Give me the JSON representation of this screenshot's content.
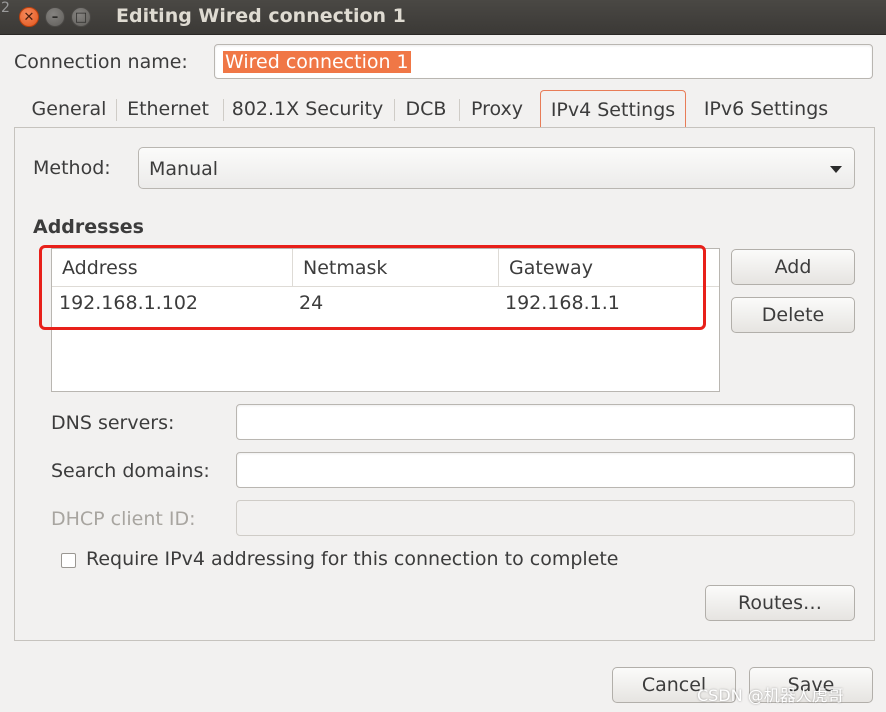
{
  "window": {
    "title": "Editing Wired connection 1",
    "stray_char": "2"
  },
  "connection": {
    "label": "Connection name:",
    "value": "Wired connection 1"
  },
  "tabs": [
    {
      "label": "General"
    },
    {
      "label": "Ethernet"
    },
    {
      "label": "802.1X Security"
    },
    {
      "label": "DCB"
    },
    {
      "label": "Proxy"
    },
    {
      "label": "IPv4 Settings",
      "active": true
    },
    {
      "label": "IPv6 Settings"
    }
  ],
  "method": {
    "label": "Method:",
    "value": "Manual"
  },
  "addresses": {
    "heading": "Addresses",
    "columns": [
      "Address",
      "Netmask",
      "Gateway"
    ],
    "rows": [
      [
        "192.168.1.102",
        "24",
        "192.168.1.1"
      ]
    ],
    "add_label": "Add",
    "delete_label": "Delete"
  },
  "fields": {
    "dns_label": "DNS servers:",
    "dns_value": "",
    "search_label": "Search domains:",
    "search_value": "",
    "dhcp_label": "DHCP client ID:",
    "dhcp_value": ""
  },
  "require_ipv4": {
    "label": "Require IPv4 addressing for this connection to complete",
    "checked": false
  },
  "routes_label": "Routes…",
  "footer": {
    "cancel_label": "Cancel",
    "save_label": "Save"
  },
  "watermark": "CSDN @机器人虎哥",
  "colors": {
    "accent": "#f07746",
    "highlight": "#e8201a",
    "titlebar": "#3c3b37"
  }
}
